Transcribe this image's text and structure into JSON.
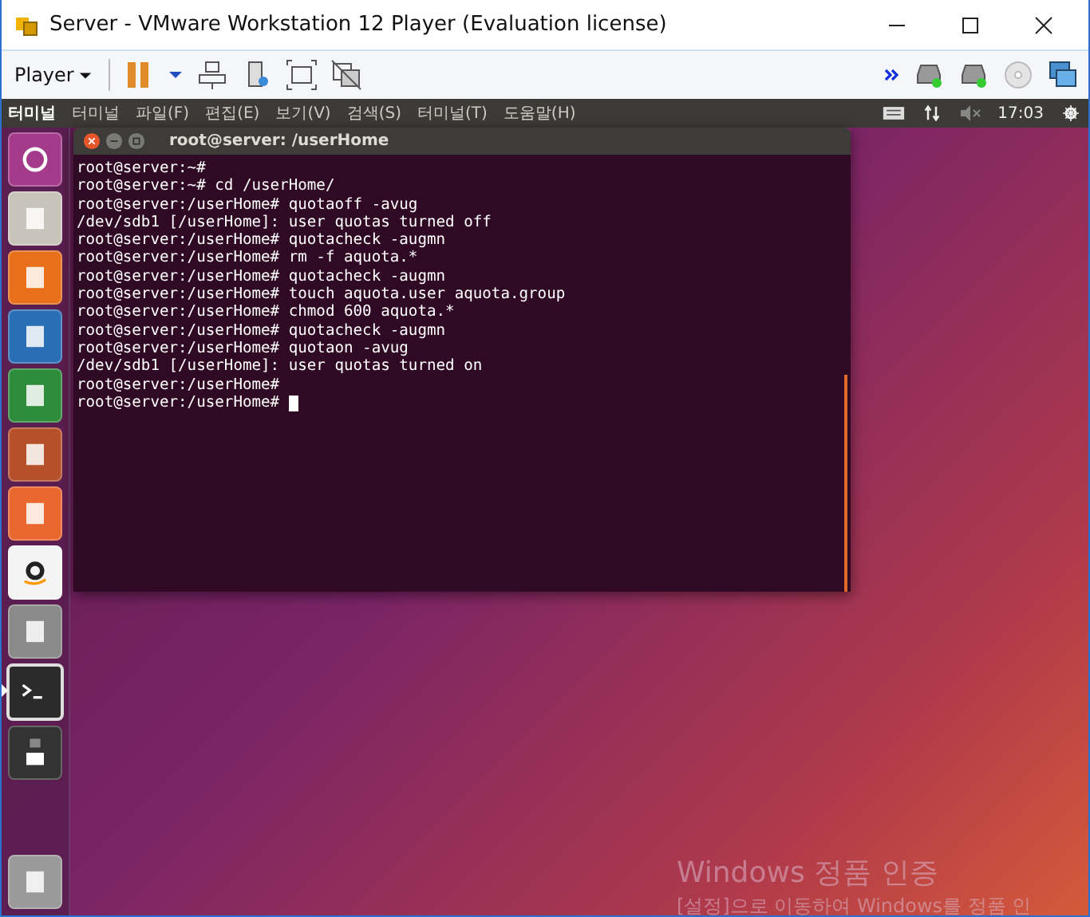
{
  "window": {
    "title": "Server - VMware Workstation 12 Player (Evaluation license)"
  },
  "toolbar": {
    "player_menu": "Player",
    "buttons": [
      {
        "kind": "pause"
      },
      {
        "kind": "dropdown"
      },
      {
        "kind": "network"
      },
      {
        "kind": "device"
      },
      {
        "kind": "fullscreen"
      },
      {
        "kind": "unity"
      }
    ],
    "devices": [
      {
        "kind": "more"
      },
      {
        "kind": "disk"
      },
      {
        "kind": "disk"
      },
      {
        "kind": "cd"
      },
      {
        "kind": "net"
      }
    ]
  },
  "top_panel": {
    "app_name": "터미널",
    "menus": [
      "터미널",
      "파일(F)",
      "편집(E)",
      "보기(V)",
      "검색(S)",
      "터미널(T)",
      "도움말(H)"
    ],
    "clock": "17:03"
  },
  "launcher": [
    {
      "kind": "ubuntu",
      "active": false
    },
    {
      "kind": "files",
      "active": false
    },
    {
      "kind": "firefox",
      "active": false
    },
    {
      "kind": "writer",
      "active": false
    },
    {
      "kind": "calc",
      "active": false
    },
    {
      "kind": "impress",
      "active": false
    },
    {
      "kind": "store",
      "active": false
    },
    {
      "kind": "amazon",
      "active": false
    },
    {
      "kind": "settings",
      "active": false
    },
    {
      "kind": "terminal",
      "active": true
    },
    {
      "kind": "save",
      "active": false
    },
    {
      "kind": "trash",
      "active": false
    }
  ],
  "terminal": {
    "title": "root@server: /userHome",
    "cursor": true,
    "lines": [
      "root@server:~#",
      "root@server:~# cd /userHome/",
      "root@server:/userHome# quotaoff -avug",
      "/dev/sdb1 [/userHome]: user quotas turned off",
      "root@server:/userHome# quotacheck -augmn",
      "root@server:/userHome# rm -f aquota.*",
      "root@server:/userHome# quotacheck -augmn",
      "root@server:/userHome# touch aquota.user aquota.group",
      "root@server:/userHome# chmod 600 aquota.*",
      "root@server:/userHome# quotacheck -augmn",
      "root@server:/userHome# quotaon -avug",
      "/dev/sdb1 [/userHome]: user quotas turned on",
      "root@server:/userHome#",
      "root@server:/userHome#"
    ]
  },
  "activation": {
    "title": "Windows 정품 인증",
    "text": "[설정]으로 이동하여 Windows를 정품 인"
  }
}
